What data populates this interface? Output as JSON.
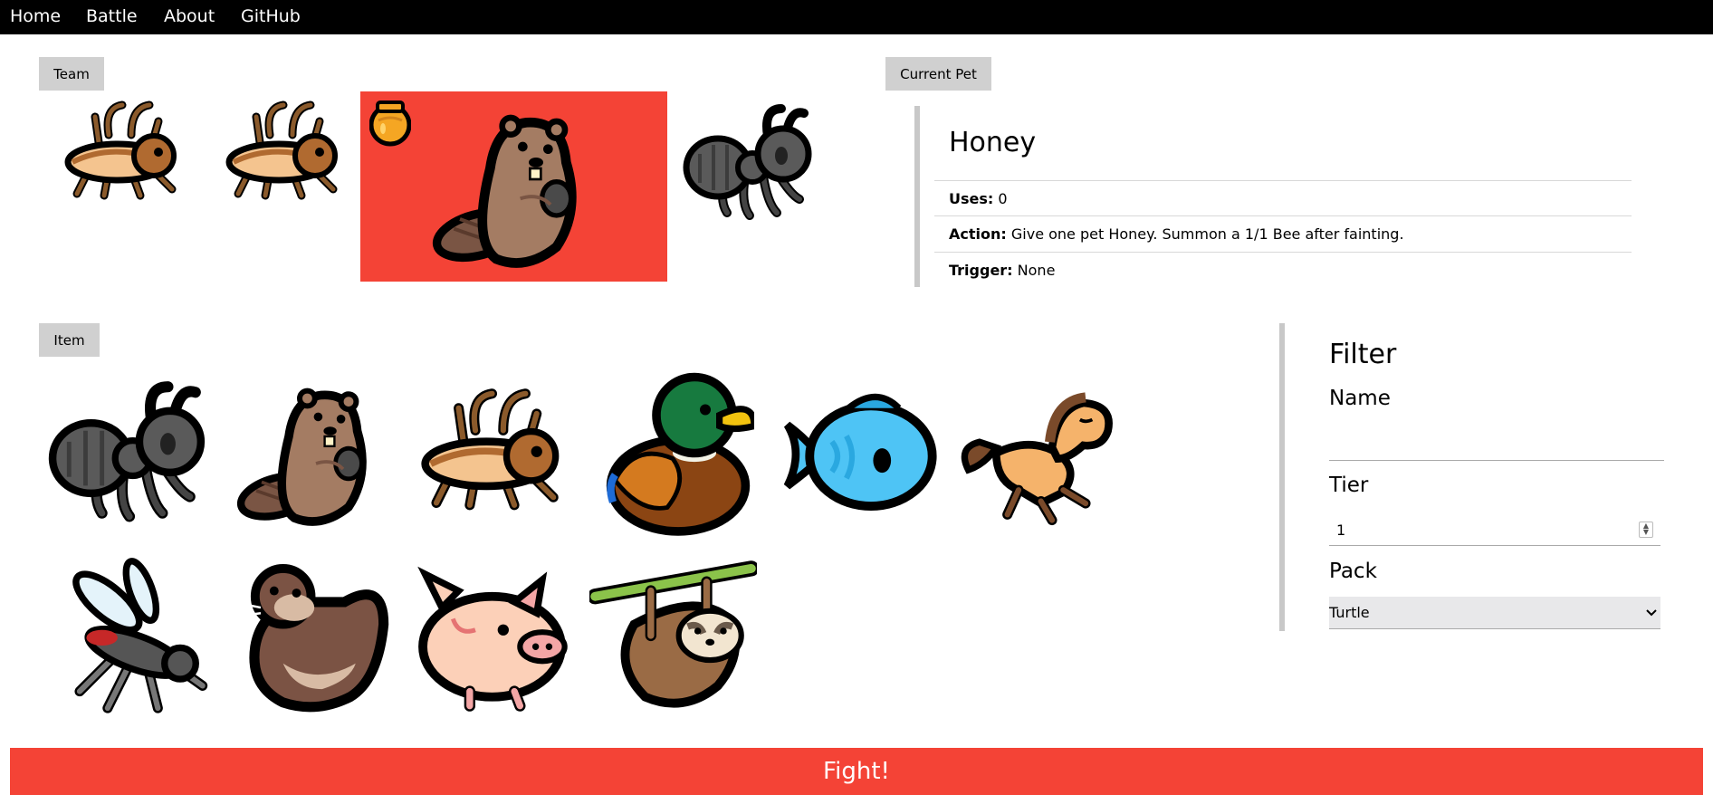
{
  "nav": {
    "items": [
      {
        "label": "Home"
      },
      {
        "label": "Battle"
      },
      {
        "label": "About"
      },
      {
        "label": "GitHub"
      }
    ]
  },
  "team": {
    "button_label": "Team",
    "slots": [
      {
        "pet": "cricket",
        "held_item": ""
      },
      {
        "pet": "cricket",
        "held_item": ""
      },
      {
        "pet": "beaver",
        "held_item": "honey",
        "selected": true
      },
      {
        "pet": "ant",
        "held_item": ""
      }
    ]
  },
  "current_pet": {
    "button_label": "Current Pet",
    "name": "Honey",
    "uses_label": "Uses:",
    "uses_value": "0",
    "action_label": "Action:",
    "action_value": "Give one pet Honey. Summon a 1/1 Bee after fainting.",
    "trigger_label": "Trigger:",
    "trigger_value": "None"
  },
  "items": {
    "button_label": "Item",
    "pets": [
      "ant",
      "beaver",
      "cricket",
      "duck",
      "fish",
      "horse",
      "mosquito",
      "otter",
      "pig",
      "sloth"
    ]
  },
  "filter": {
    "title": "Filter",
    "name_label": "Name",
    "name_value": "",
    "tier_label": "Tier",
    "tier_value": "1",
    "pack_label": "Pack",
    "pack_value": "Turtle"
  },
  "fight_label": "Fight!",
  "colors": {
    "accent": "#f44336",
    "nav_bg": "#000000",
    "section_button_bg": "#d0d0d0"
  }
}
